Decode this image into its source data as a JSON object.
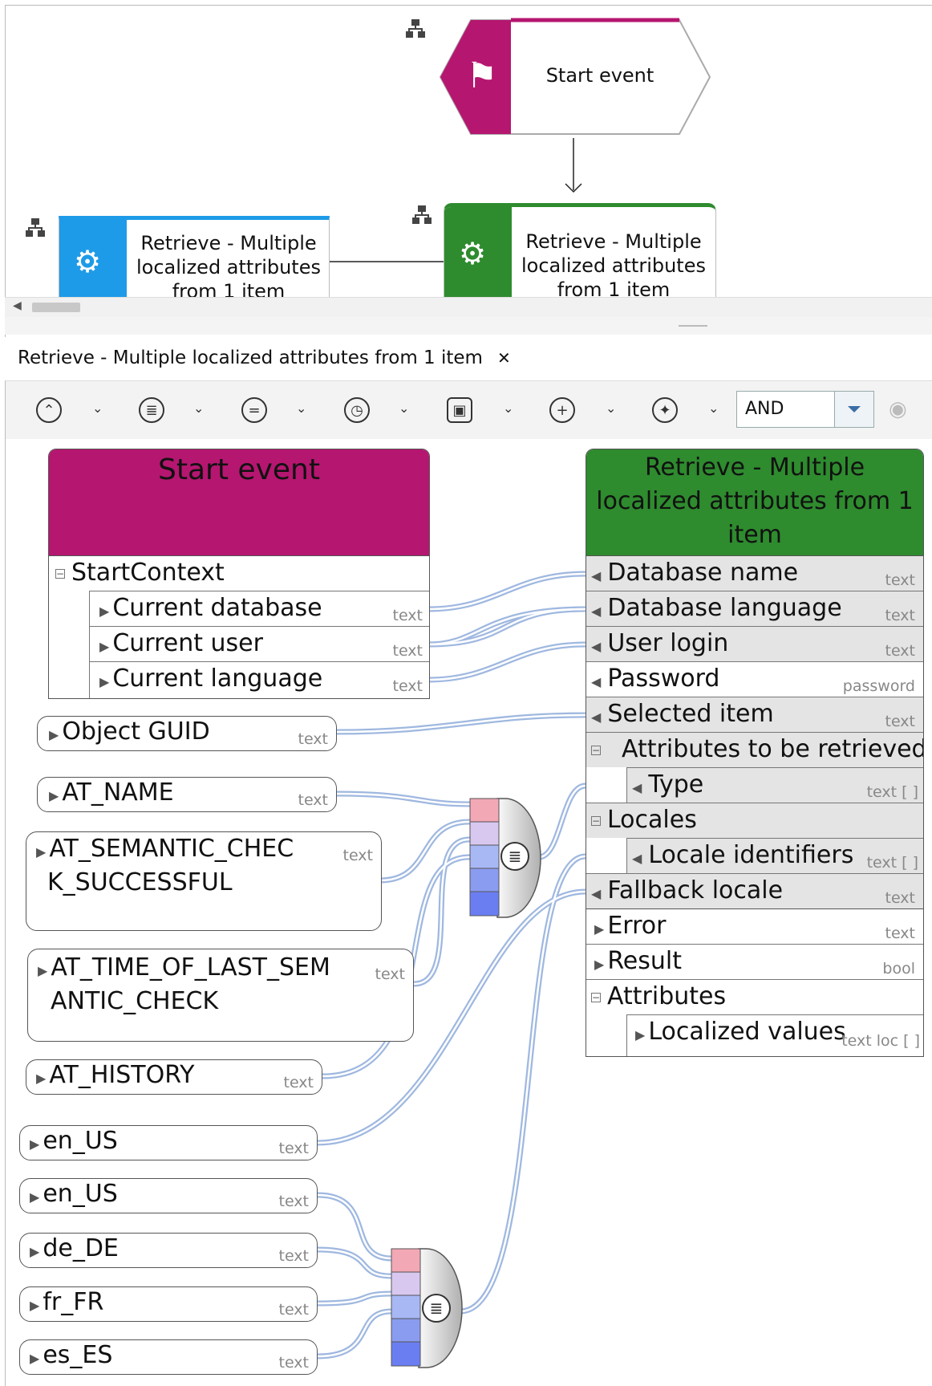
{
  "diagram": {
    "start_event": {
      "label": "Start event",
      "color": "#b51670"
    },
    "function_blue": {
      "label": "Retrieve - Multiple localized attributes from 1 item",
      "color": "#1e9be8"
    },
    "function_green": {
      "label": "Retrieve - Multiple localized attributes from 1 item",
      "color": "#2e8b2e"
    }
  },
  "tab": {
    "title": "Retrieve - Multiple localized attributes from 1 item",
    "close": "✕"
  },
  "toolbar": {
    "combo_value": "AND"
  },
  "left_box": {
    "title": "Start event",
    "color": "#b51670",
    "group": "StartContext",
    "rows": [
      {
        "label": "Current database",
        "type": "text"
      },
      {
        "label": "Current user",
        "type": "text"
      },
      {
        "label": "Current language",
        "type": "text"
      }
    ]
  },
  "pills": [
    {
      "label": "Object GUID",
      "type": "text"
    },
    {
      "label": "AT_NAME",
      "type": "text"
    },
    {
      "label": "AT_SEMANTIC_CHEC",
      "label2": "K_SUCCESSFUL",
      "type": "text"
    },
    {
      "label": "AT_TIME_OF_LAST_SEM",
      "label2": "ANTIC_CHECK",
      "type": "text"
    },
    {
      "label": "AT_HISTORY",
      "type": "text"
    },
    {
      "label": "en_US",
      "type": "text"
    },
    {
      "label": "en_US",
      "type": "text"
    },
    {
      "label": "de_DE",
      "type": "text"
    },
    {
      "label": "fr_FR",
      "type": "text"
    },
    {
      "label": "es_ES",
      "type": "text"
    }
  ],
  "right_box": {
    "title": "Retrieve - Multiple localized attributes from 1 item",
    "color": "#2e8b2e",
    "rows": [
      {
        "label": "Database name",
        "type": "text"
      },
      {
        "label": "Database language",
        "type": "text"
      },
      {
        "label": "User login",
        "type": "text"
      },
      {
        "label": "Password",
        "type": "password"
      },
      {
        "label": "Selected item",
        "type": "text"
      },
      {
        "label": "Attributes to be retrieved",
        "type": ""
      },
      {
        "label": "Type",
        "type": "text [ ]"
      },
      {
        "label": "Locales",
        "type": ""
      },
      {
        "label": "Locale identifiers",
        "type": "text [ ]"
      },
      {
        "label": "Fallback locale",
        "type": "text"
      },
      {
        "label": "Error",
        "type": "text"
      },
      {
        "label": "Result",
        "type": "bool"
      },
      {
        "label": "Attributes",
        "type": ""
      },
      {
        "label": "Localized values",
        "type": "text loc [ ]"
      }
    ]
  }
}
